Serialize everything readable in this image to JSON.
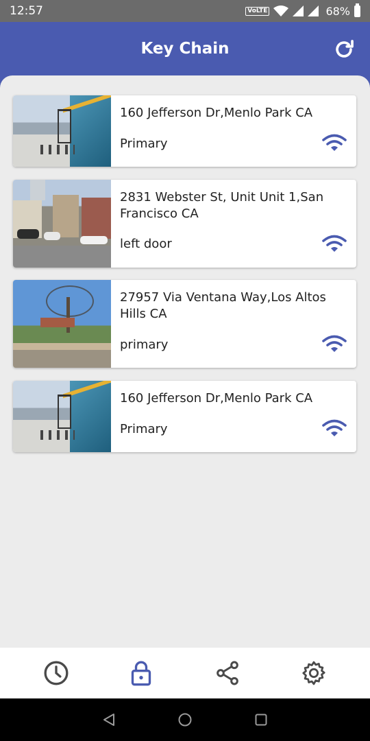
{
  "status_bar": {
    "time": "12:57",
    "volte": "VoLTE",
    "battery": "68%"
  },
  "header": {
    "title": "Key Chain",
    "refresh_icon": "refresh-icon"
  },
  "keys": [
    {
      "address": "160 Jefferson Dr,Menlo Park CA",
      "label": "Primary",
      "thumbnail": "plaza",
      "status_icon": "wifi-icon"
    },
    {
      "address": "2831 Webster St, Unit Unit 1,San Francisco CA",
      "label": "left door",
      "thumbnail": "street",
      "status_icon": "wifi-icon"
    },
    {
      "address": "27957 Via Ventana Way,Los Altos Hills CA",
      "label": "primary",
      "thumbnail": "tree",
      "status_icon": "wifi-icon"
    },
    {
      "address": "160 Jefferson Dr,Menlo Park CA",
      "label": "Primary",
      "thumbnail": "plaza",
      "status_icon": "wifi-icon"
    }
  ],
  "bottom_nav": {
    "items": [
      "history-icon",
      "lock-icon",
      "share-icon",
      "settings-icon"
    ],
    "active": "lock-icon"
  },
  "colors": {
    "primary": "#4a5bb0",
    "icon_gray": "#4a4a4a",
    "status_bar": "#6b6b6b"
  }
}
